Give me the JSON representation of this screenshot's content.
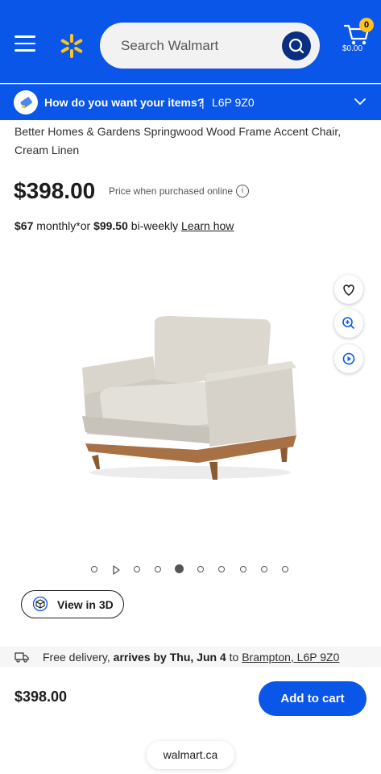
{
  "header": {
    "search_placeholder": "Search Walmart",
    "cart_count": "0",
    "cart_total": "$0.00",
    "brand_color": "#0a56e8",
    "spark_color": "#ffc220"
  },
  "delivery_bar": {
    "question": "How do you want your items?",
    "separator": "|",
    "postal_code": "L6P 9Z0"
  },
  "product": {
    "title": "Better Homes & Gardens Springwood Wood Frame Accent Chair, Cream Linen",
    "price": "$398.00",
    "price_note": "Price when purchased online",
    "finance": {
      "monthly_amount": "$67",
      "monthly_text": "monthly*or",
      "biweekly_amount": "$99.50",
      "biweekly_text": "bi-weekly",
      "learn_link": "Learn how"
    }
  },
  "gallery": {
    "side_buttons": [
      "heart-icon",
      "zoom-in-icon",
      "play-icon"
    ],
    "dots_total": 10,
    "active_index": 4,
    "view3d_label": "View in 3D"
  },
  "free_delivery": {
    "prefix": "Free delivery,",
    "arrives": "arrives by Thu, Jun 4",
    "to": "to",
    "location": "Brampton, L6P 9Z0"
  },
  "footer": {
    "price": "$398.00",
    "add_to_cart": "Add to cart",
    "url": "walmart.ca"
  }
}
